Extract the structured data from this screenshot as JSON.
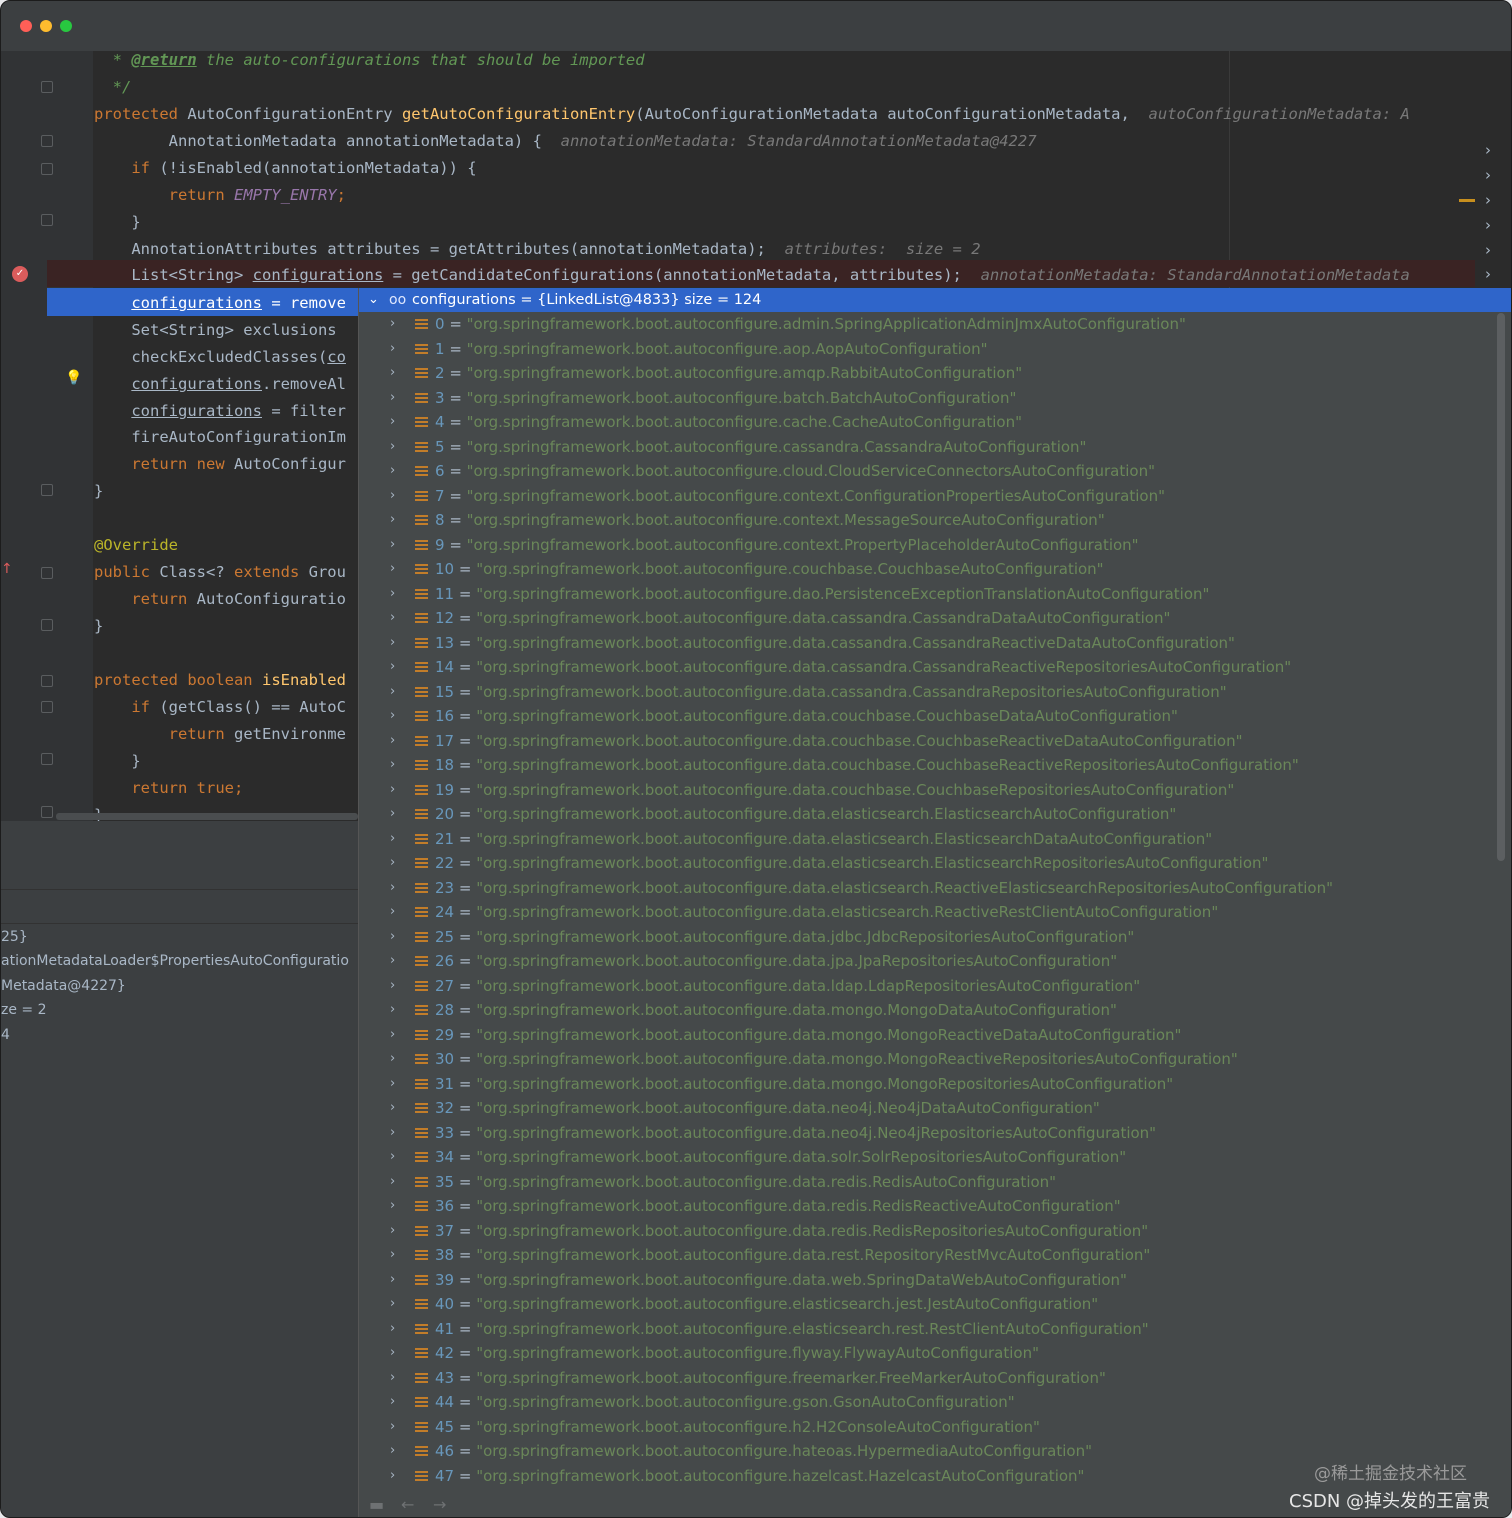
{
  "code": {
    "line_comment_return": "@return",
    "line_comment_text": " the auto-configurations that should be imported",
    "line_comment_star": "* ",
    "line_comment_end": "*/",
    "l1_kw": "protected ",
    "l1_type": "AutoConfigurationEntry ",
    "l1_fn": "getAutoConfigurationEntry",
    "l1_rest": "(AutoConfigurationMetadata autoConfigurationMetadata,",
    "l1_hint": "autoConfigurationMetadata: A",
    "l2_rest": "AnnotationMetadata annotationMetadata) {",
    "l2_hint": "annotationMetadata: StandardAnnotationMetadata@4227",
    "l3_kw": "if ",
    "l3_rest": "(!isEnabled(annotationMetadata)) {",
    "l4_kw": "return ",
    "l4_const": "EMPTY_ENTRY",
    "l4_semi": ";",
    "brace": "}",
    "l6_rest": "AnnotationAttributes attributes = getAttributes(annotationMetadata);",
    "l6_hint": "attributes:  size = 2",
    "l7_pre": "List<String> ",
    "l7_var": "configurations",
    "l7_rest": " = getCandidateConfigurations(annotationMetadata, attributes);",
    "l7_hint": "annotationMetadata: StandardAnnotationMetadata",
    "l8_var": "configurations",
    "l8_rest": " = remove",
    "l9_rest": "Set<String> exclusions",
    "l10_pre": "checkExcludedClasses(",
    "l10_var": "co",
    "l11_var": "configurations",
    "l11_rest": ".removeAl",
    "l12_var": "configurations",
    "l12_rest": " = filter",
    "l13_rest": "fireAutoConfigurationIm",
    "l14_kw": "return new ",
    "l14_rest": "AutoConfigur",
    "override": "@Override",
    "l17_kw": "public ",
    "l17_rest1": "Class<? ",
    "l17_kw2": "extends ",
    "l17_rest2": "Grou",
    "l18_kw": "return ",
    "l18_rest": "AutoConfiguratio",
    "l20_kw": "protected boolean ",
    "l20_fn": "isEnabled",
    "l21_kw": "if ",
    "l21_rest": "(getClass() == AutoC",
    "l22_kw": "return ",
    "l22_rest": "getEnvironme",
    "l24_kw": "return true",
    "l24_semi": ";"
  },
  "variables_panel": {
    "lines": [
      "25}",
      "ationMetadataLoader$PropertiesAutoConfiguratio",
      "Metadata@4227}",
      "ze = 2",
      "4"
    ]
  },
  "popup": {
    "header": "configurations = {LinkedList@4833}  size = 124",
    "items": [
      "\"org.springframework.boot.autoconfigure.admin.SpringApplicationAdminJmxAutoConfiguration\"",
      "\"org.springframework.boot.autoconfigure.aop.AopAutoConfiguration\"",
      "\"org.springframework.boot.autoconfigure.amqp.RabbitAutoConfiguration\"",
      "\"org.springframework.boot.autoconfigure.batch.BatchAutoConfiguration\"",
      "\"org.springframework.boot.autoconfigure.cache.CacheAutoConfiguration\"",
      "\"org.springframework.boot.autoconfigure.cassandra.CassandraAutoConfiguration\"",
      "\"org.springframework.boot.autoconfigure.cloud.CloudServiceConnectorsAutoConfiguration\"",
      "\"org.springframework.boot.autoconfigure.context.ConfigurationPropertiesAutoConfiguration\"",
      "\"org.springframework.boot.autoconfigure.context.MessageSourceAutoConfiguration\"",
      "\"org.springframework.boot.autoconfigure.context.PropertyPlaceholderAutoConfiguration\"",
      "\"org.springframework.boot.autoconfigure.couchbase.CouchbaseAutoConfiguration\"",
      "\"org.springframework.boot.autoconfigure.dao.PersistenceExceptionTranslationAutoConfiguration\"",
      "\"org.springframework.boot.autoconfigure.data.cassandra.CassandraDataAutoConfiguration\"",
      "\"org.springframework.boot.autoconfigure.data.cassandra.CassandraReactiveDataAutoConfiguration\"",
      "\"org.springframework.boot.autoconfigure.data.cassandra.CassandraReactiveRepositoriesAutoConfiguration\"",
      "\"org.springframework.boot.autoconfigure.data.cassandra.CassandraRepositoriesAutoConfiguration\"",
      "\"org.springframework.boot.autoconfigure.data.couchbase.CouchbaseDataAutoConfiguration\"",
      "\"org.springframework.boot.autoconfigure.data.couchbase.CouchbaseReactiveDataAutoConfiguration\"",
      "\"org.springframework.boot.autoconfigure.data.couchbase.CouchbaseReactiveRepositoriesAutoConfiguration\"",
      "\"org.springframework.boot.autoconfigure.data.couchbase.CouchbaseRepositoriesAutoConfiguration\"",
      "\"org.springframework.boot.autoconfigure.data.elasticsearch.ElasticsearchAutoConfiguration\"",
      "\"org.springframework.boot.autoconfigure.data.elasticsearch.ElasticsearchDataAutoConfiguration\"",
      "\"org.springframework.boot.autoconfigure.data.elasticsearch.ElasticsearchRepositoriesAutoConfiguration\"",
      "\"org.springframework.boot.autoconfigure.data.elasticsearch.ReactiveElasticsearchRepositoriesAutoConfiguration\"",
      "\"org.springframework.boot.autoconfigure.data.elasticsearch.ReactiveRestClientAutoConfiguration\"",
      "\"org.springframework.boot.autoconfigure.data.jdbc.JdbcRepositoriesAutoConfiguration\"",
      "\"org.springframework.boot.autoconfigure.data.jpa.JpaRepositoriesAutoConfiguration\"",
      "\"org.springframework.boot.autoconfigure.data.ldap.LdapRepositoriesAutoConfiguration\"",
      "\"org.springframework.boot.autoconfigure.data.mongo.MongoDataAutoConfiguration\"",
      "\"org.springframework.boot.autoconfigure.data.mongo.MongoReactiveDataAutoConfiguration\"",
      "\"org.springframework.boot.autoconfigure.data.mongo.MongoReactiveRepositoriesAutoConfiguration\"",
      "\"org.springframework.boot.autoconfigure.data.mongo.MongoRepositoriesAutoConfiguration\"",
      "\"org.springframework.boot.autoconfigure.data.neo4j.Neo4jDataAutoConfiguration\"",
      "\"org.springframework.boot.autoconfigure.data.neo4j.Neo4jRepositoriesAutoConfiguration\"",
      "\"org.springframework.boot.autoconfigure.data.solr.SolrRepositoriesAutoConfiguration\"",
      "\"org.springframework.boot.autoconfigure.data.redis.RedisAutoConfiguration\"",
      "\"org.springframework.boot.autoconfigure.data.redis.RedisReactiveAutoConfiguration\"",
      "\"org.springframework.boot.autoconfigure.data.redis.RedisRepositoriesAutoConfiguration\"",
      "\"org.springframework.boot.autoconfigure.data.rest.RepositoryRestMvcAutoConfiguration\"",
      "\"org.springframework.boot.autoconfigure.data.web.SpringDataWebAutoConfiguration\"",
      "\"org.springframework.boot.autoconfigure.elasticsearch.jest.JestAutoConfiguration\"",
      "\"org.springframework.boot.autoconfigure.elasticsearch.rest.RestClientAutoConfiguration\"",
      "\"org.springframework.boot.autoconfigure.flyway.FlywayAutoConfiguration\"",
      "\"org.springframework.boot.autoconfigure.freemarker.FreeMarkerAutoConfiguration\"",
      "\"org.springframework.boot.autoconfigure.gson.GsonAutoConfiguration\"",
      "\"org.springframework.boot.autoconfigure.h2.H2ConsoleAutoConfiguration\"",
      "\"org.springframework.boot.autoconfigure.hateoas.HypermediaAutoConfiguration\"",
      "\"org.springframework.boot.autoconfigure.hazelcast.HazelcastAutoConfiguration\""
    ]
  },
  "watermark": {
    "line1": "@稀土掘金技术社区",
    "line2": "CSDN @掉头发的王富贵"
  },
  "colors": {
    "selection": "#2f65ca",
    "string": "#6a8759",
    "keyword": "#cc7832",
    "number": "#6897bb"
  }
}
